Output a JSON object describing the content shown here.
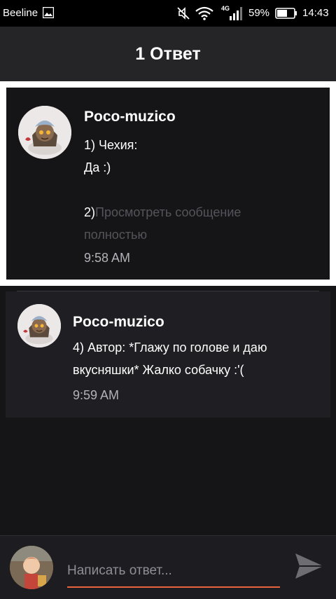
{
  "status_bar": {
    "carrier": "Beeline",
    "network_type": "4G",
    "battery_percent": "59%",
    "time": "14:43"
  },
  "header": {
    "title": "1 Ответ"
  },
  "comments": [
    {
      "author": "Poco-muzico",
      "text_line1": "1) Чехия:",
      "text_line2": "Да :)",
      "text_line4_prefix": "2)",
      "text_faded": "Просмотреть сообщение полностью",
      "time": "9:58 AM"
    },
    {
      "author": "Poco-muzico",
      "text": "4) Автор: *Глажу по голове и даю вкусняшки* Жалко собачку :'(",
      "time": "9:59 AM"
    }
  ],
  "reply": {
    "placeholder": "Написать ответ..."
  },
  "colors": {
    "accent": "#e8623c",
    "background": "#151417",
    "header": "#252427",
    "card": "#1f1e22"
  }
}
